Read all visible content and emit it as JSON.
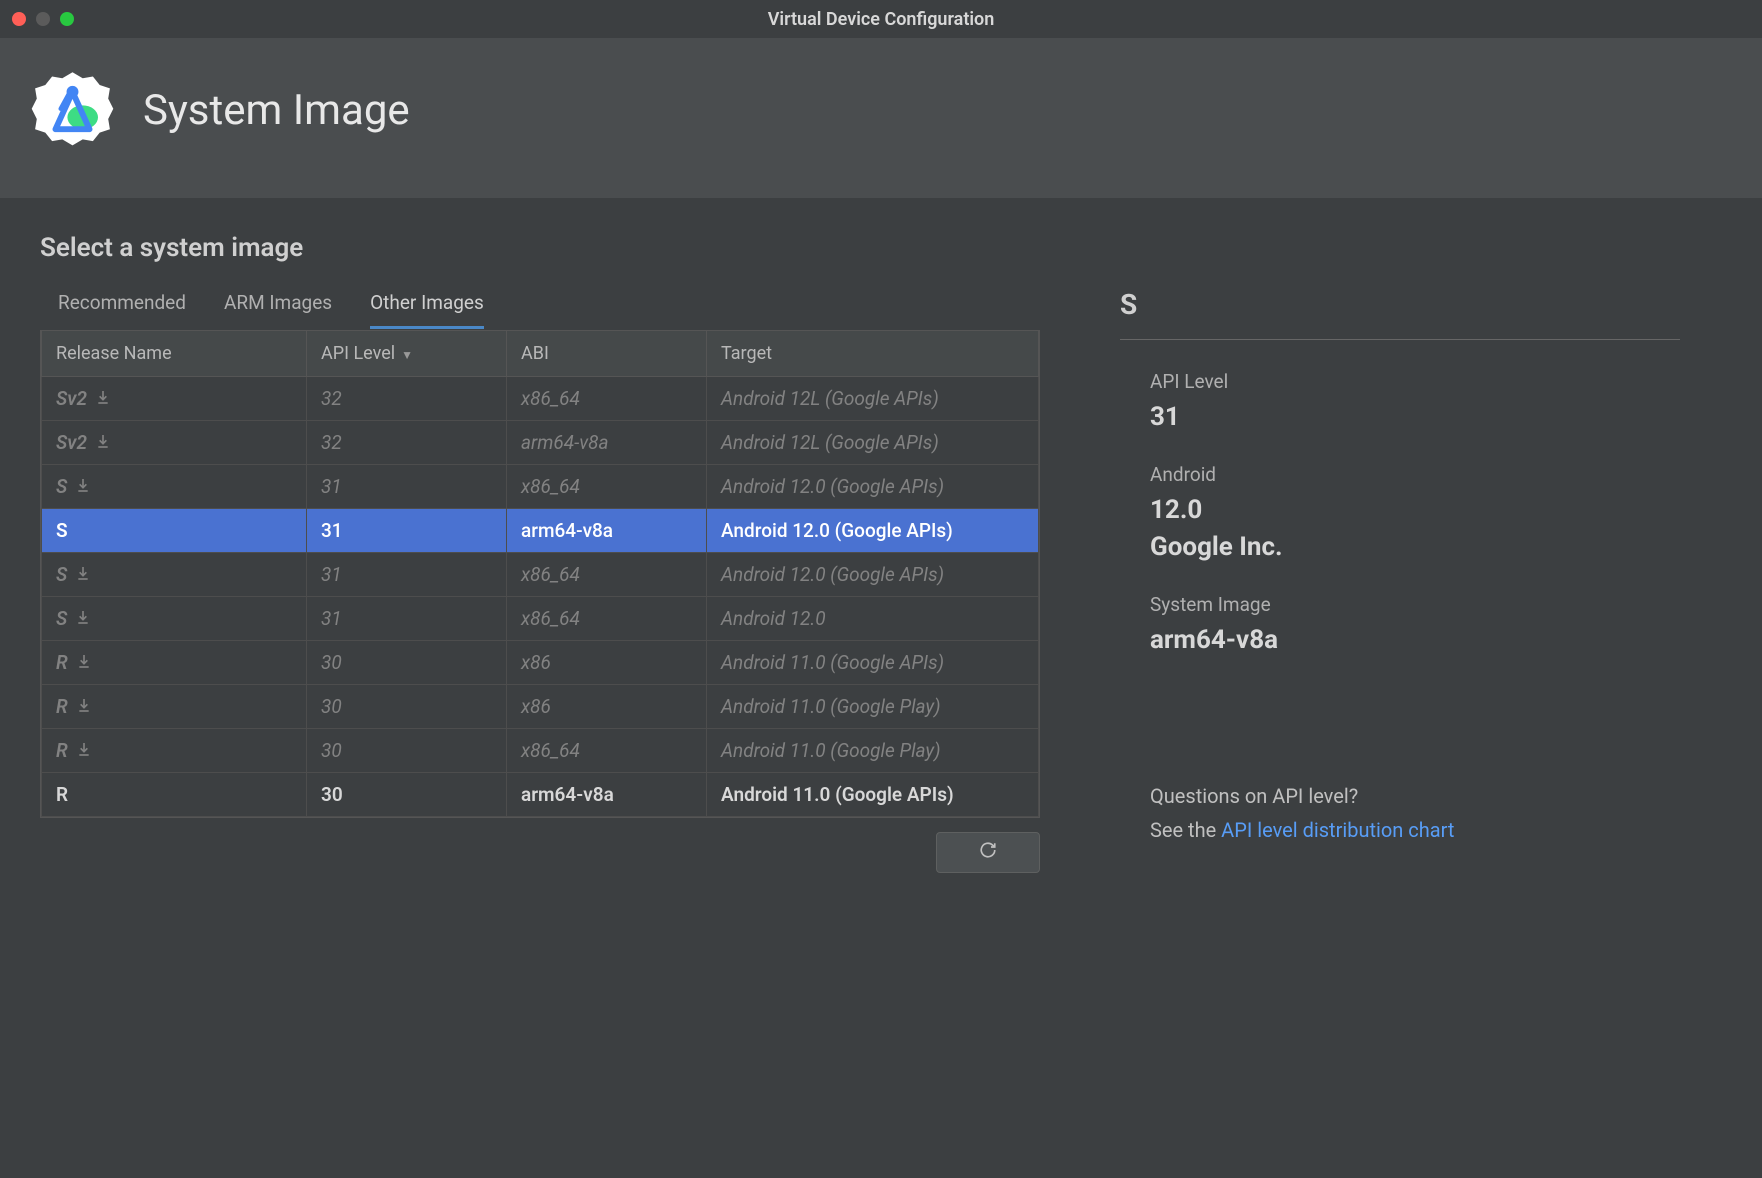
{
  "window": {
    "title": "Virtual Device Configuration"
  },
  "header": {
    "title": "System Image"
  },
  "section": {
    "title": "Select a system image"
  },
  "tabs": [
    {
      "label": "Recommended",
      "active": false
    },
    {
      "label": "ARM Images",
      "active": false
    },
    {
      "label": "Other Images",
      "active": true
    }
  ],
  "columns": {
    "release": "Release Name",
    "api": "API Level",
    "abi": "ABI",
    "target": "Target"
  },
  "rows": [
    {
      "release": "Sv2",
      "api": "32",
      "abi": "x86_64",
      "target": "Android 12L (Google APIs)",
      "downloadable": true,
      "selected": false,
      "installed": false
    },
    {
      "release": "Sv2",
      "api": "32",
      "abi": "arm64-v8a",
      "target": "Android 12L (Google APIs)",
      "downloadable": true,
      "selected": false,
      "installed": false
    },
    {
      "release": "S",
      "api": "31",
      "abi": "x86_64",
      "target": "Android 12.0 (Google APIs)",
      "downloadable": true,
      "selected": false,
      "installed": false
    },
    {
      "release": "S",
      "api": "31",
      "abi": "arm64-v8a",
      "target": "Android 12.0 (Google APIs)",
      "downloadable": false,
      "selected": true,
      "installed": true
    },
    {
      "release": "S",
      "api": "31",
      "abi": "x86_64",
      "target": "Android 12.0 (Google APIs)",
      "downloadable": true,
      "selected": false,
      "installed": false
    },
    {
      "release": "S",
      "api": "31",
      "abi": "x86_64",
      "target": "Android 12.0",
      "downloadable": true,
      "selected": false,
      "installed": false
    },
    {
      "release": "R",
      "api": "30",
      "abi": "x86",
      "target": "Android 11.0 (Google APIs)",
      "downloadable": true,
      "selected": false,
      "installed": false
    },
    {
      "release": "R",
      "api": "30",
      "abi": "x86",
      "target": "Android 11.0 (Google Play)",
      "downloadable": true,
      "selected": false,
      "installed": false
    },
    {
      "release": "R",
      "api": "30",
      "abi": "x86_64",
      "target": "Android 11.0 (Google Play)",
      "downloadable": true,
      "selected": false,
      "installed": false
    },
    {
      "release": "R",
      "api": "30",
      "abi": "arm64-v8a",
      "target": "Android 11.0 (Google APIs)",
      "downloadable": false,
      "selected": false,
      "installed": true
    }
  ],
  "details": {
    "header": "S",
    "api_label": "API Level",
    "api_value": "31",
    "android_label": "Android",
    "android_version": "12.0",
    "vendor": "Google Inc.",
    "sysimage_label": "System Image",
    "sysimage_value": "arm64-v8a",
    "questions_title": "Questions on API level?",
    "questions_prefix": "See the ",
    "questions_link": "API level distribution chart"
  }
}
